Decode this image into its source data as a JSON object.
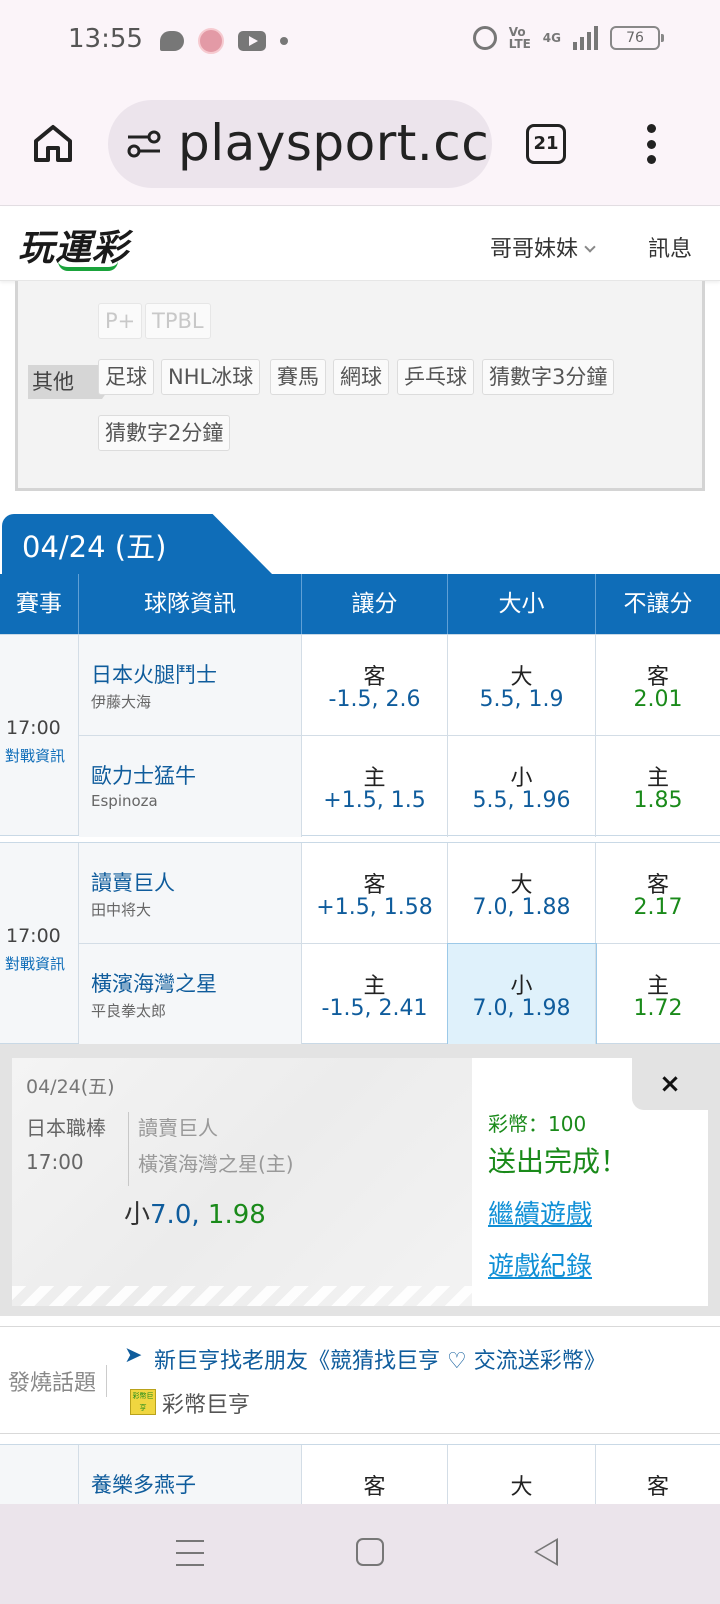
{
  "status_bar": {
    "time": "13:55",
    "network_text": "Vo LTE",
    "network_gen": "4G",
    "battery": "76"
  },
  "browser": {
    "url": "playsport.cc",
    "tab_count": "21"
  },
  "site_header": {
    "logo_text": "玩運彩",
    "user_menu": "哥哥妹妹",
    "messages": "訊息"
  },
  "categories": {
    "row_faded": [
      "P+",
      "TPBL"
    ],
    "other_label": "其他",
    "other_items": [
      "足球",
      "NHL冰球",
      "賽馬",
      "網球",
      "乒乓球",
      "猜數字3分鐘"
    ],
    "other_items_2": [
      "猜數字2分鐘"
    ]
  },
  "date_tab": "04/24 (五)",
  "table_headers": [
    "賽事",
    "球隊資訊",
    "讓分",
    "大小",
    "不讓分"
  ],
  "games": [
    {
      "time": "17:00",
      "link": "對戰資訊",
      "away": {
        "team": "日本火腿鬥士",
        "pitcher": "伊藤大海",
        "spread_label": "客",
        "spread_value": "-1.5, 2.6",
        "total_label": "大",
        "total_value": "5.5, 1.9",
        "ml_label": "客",
        "ml_value": "2.01"
      },
      "home": {
        "team": "歐力士猛牛",
        "pitcher": "Espinoza",
        "spread_label": "主",
        "spread_value": "+1.5, 1.5",
        "total_label": "小",
        "total_value": "5.5, 1.96",
        "ml_label": "主",
        "ml_value": "1.85"
      }
    },
    {
      "time": "17:00",
      "link": "對戰資訊",
      "away": {
        "team": "讀賣巨人",
        "pitcher": "田中将大",
        "spread_label": "客",
        "spread_value": "+1.5, 1.58",
        "total_label": "大",
        "total_value": "7.0, 1.88",
        "ml_label": "客",
        "ml_value": "2.17"
      },
      "home": {
        "team": "橫濱海灣之星",
        "pitcher": "平良拳太郎",
        "spread_label": "主",
        "spread_value": "-1.5, 2.41",
        "total_label": "小",
        "total_value": "7.0, 1.98",
        "ml_label": "主",
        "ml_value": "1.72"
      }
    }
  ],
  "confirmation": {
    "date": "04/24(五)",
    "league": "日本職棒",
    "time": "17:00",
    "team1": "讀賣巨人",
    "team2": "橫濱海灣之星(主)",
    "pick_label": "小",
    "pick_line": "7.0, ",
    "pick_odds": "1.98",
    "coins": "彩幣：100",
    "status": "送出完成！",
    "continue_link": "繼續遊戲",
    "history_link": "遊戲紀錄",
    "close": "×"
  },
  "hot_topic": {
    "label": "發燒話題",
    "arrow": "➤",
    "title": "新巨亨找老朋友《競猜找巨亨 ♡ 交流送彩幣》",
    "badge": "彩幣巨亨",
    "author": "彩幣巨亨"
  },
  "partial_game": {
    "team": "養樂多燕子",
    "spread_label": "客",
    "total_label": "大",
    "ml_label": "客"
  },
  "colors": {
    "brand_blue": "#0f6db8",
    "odds_green": "#1a8a1a",
    "link_blue": "#0f8fd6"
  }
}
